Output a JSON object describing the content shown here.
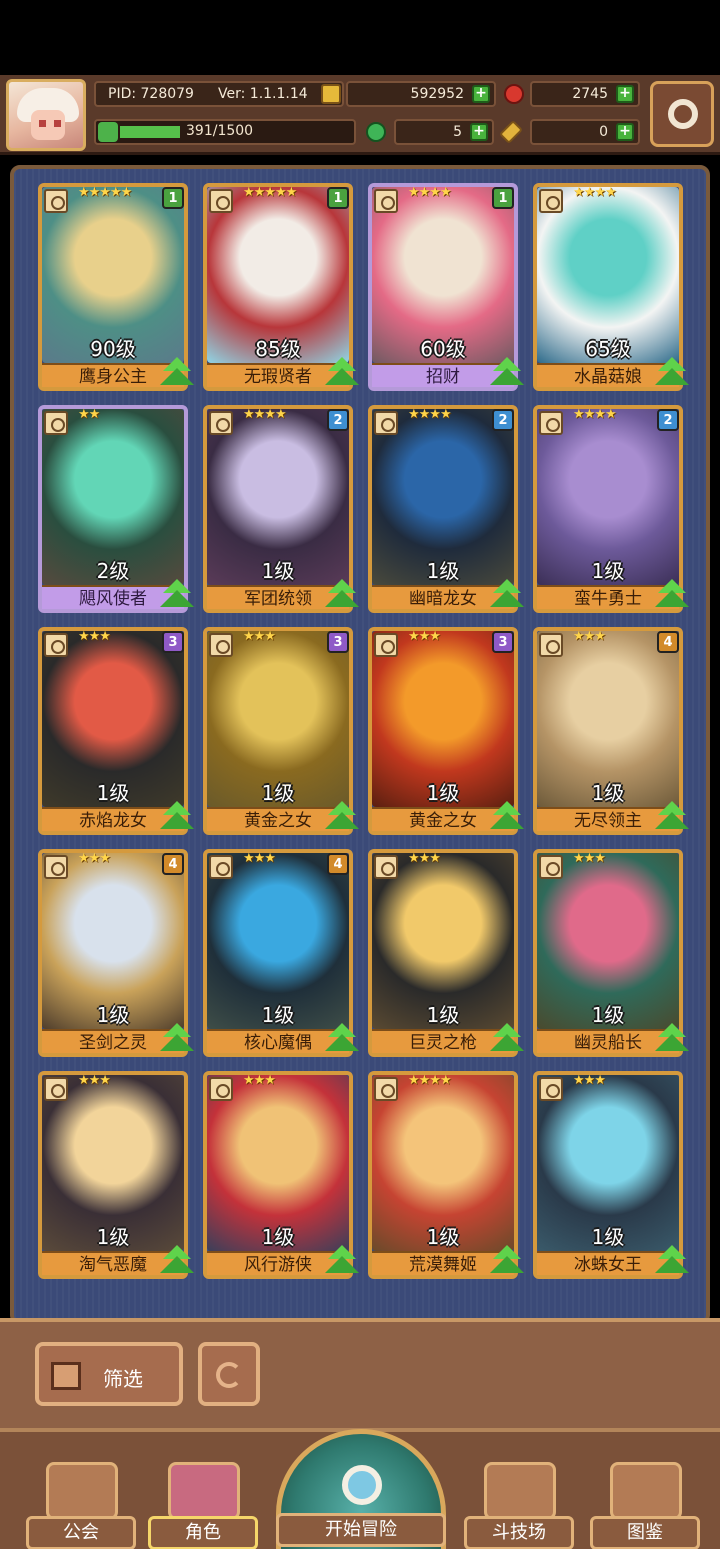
{
  "header": {
    "pid": "PID: 728079",
    "version": "Ver: 1.1.1.14",
    "gold": "592952",
    "gems": "2745",
    "energy": "391/1500",
    "energy_fraction": 0.26,
    "clover": "5",
    "keys": "0"
  },
  "cards": [
    {
      "name": "鹰身公主",
      "level": "90级",
      "stars": "★★★★★",
      "badge": "1",
      "badge_color": "#4aa23f",
      "frame": "gold",
      "art": [
        "#5b7a8a",
        "#e8d08b",
        "#4e8f86"
      ]
    },
    {
      "name": "无瑕贤者",
      "level": "85级",
      "stars": "★★★★★",
      "badge": "1",
      "badge_color": "#4aa23f",
      "frame": "gold",
      "art": [
        "#8fd6e6",
        "#f2ece6",
        "#b8363a"
      ]
    },
    {
      "name": "招财",
      "level": "60级",
      "stars": "★★★★",
      "badge": "1",
      "badge_color": "#4aa23f",
      "frame": "purple",
      "art": [
        "#6f5a62",
        "#f0e3d2",
        "#e46a86"
      ]
    },
    {
      "name": "水晶菇娘",
      "level": "65级",
      "stars": "★★★★",
      "badge": "",
      "badge_color": "",
      "frame": "gold",
      "art": [
        "#2d6a8a",
        "#5fd0c6",
        "#f3f4f3"
      ]
    },
    {
      "name": "飓风使者",
      "level": "2级",
      "stars": "★★",
      "badge": "",
      "badge_color": "",
      "frame": "purple",
      "art": [
        "#574a3e",
        "#62d6b6",
        "#2a4e3f"
      ]
    },
    {
      "name": "军团统领",
      "level": "1级",
      "stars": "★★★★",
      "badge": "2",
      "badge_color": "#3e8fd1",
      "frame": "gold",
      "art": [
        "#5a3b58",
        "#c9bde2",
        "#3a2c44"
      ]
    },
    {
      "name": "幽暗龙女",
      "level": "1级",
      "stars": "★★★★",
      "badge": "2",
      "badge_color": "#3e8fd1",
      "frame": "gold",
      "art": [
        "#4a4a3c",
        "#2b66a8",
        "#1f2b3c"
      ]
    },
    {
      "name": "蛮牛勇士",
      "level": "1级",
      "stars": "★★★★",
      "badge": "2",
      "badge_color": "#3e8fd1",
      "frame": "gold",
      "art": [
        "#3b2f56",
        "#a88dd0",
        "#6d5a9a"
      ]
    },
    {
      "name": "赤焰龙女",
      "level": "1级",
      "stars": "★★★",
      "badge": "3",
      "badge_color": "#8f5ac7",
      "frame": "gold",
      "art": [
        "#3f3a2a",
        "#e25a46",
        "#2a2a2a"
      ]
    },
    {
      "name": "黄金之女",
      "level": "1级",
      "stars": "★★★",
      "badge": "3",
      "badge_color": "#8f5ac7",
      "frame": "gold",
      "art": [
        "#6a5a2a",
        "#e3c25a",
        "#8a6a20"
      ]
    },
    {
      "name": "黄金之女",
      "level": "1级",
      "stars": "★★★",
      "badge": "3",
      "badge_color": "#8f5ac7",
      "frame": "gold",
      "art": [
        "#5a1f10",
        "#f39a2a",
        "#c1381e"
      ]
    },
    {
      "name": "无尽领主",
      "level": "1级",
      "stars": "★★★",
      "badge": "4",
      "badge_color": "#d28a2a",
      "frame": "gold",
      "art": [
        "#6d5a3a",
        "#e7cfa2",
        "#b59466"
      ]
    },
    {
      "name": "圣剑之灵",
      "level": "1级",
      "stars": "★★★",
      "badge": "4",
      "badge_color": "#d28a2a",
      "frame": "gold",
      "art": [
        "#4e3d2c",
        "#d8e1ec",
        "#c9a25a"
      ]
    },
    {
      "name": "核心魔偶",
      "level": "1级",
      "stars": "★★★",
      "badge": "4",
      "badge_color": "#d28a2a",
      "frame": "gold",
      "art": [
        "#3f4e48",
        "#3aa8e0",
        "#1f2f3a"
      ]
    },
    {
      "name": "巨灵之枪",
      "level": "1级",
      "stars": "★★★",
      "badge": "",
      "badge_color": "",
      "frame": "gold",
      "art": [
        "#5a4a32",
        "#f1c96a",
        "#2a2a2a"
      ]
    },
    {
      "name": "幽灵船长",
      "level": "1级",
      "stars": "★★★",
      "badge": "",
      "badge_color": "",
      "frame": "gold",
      "art": [
        "#4a4a2e",
        "#e06a8a",
        "#2f6a5a"
      ]
    },
    {
      "name": "淘气恶魔",
      "level": "1级",
      "stars": "★★★",
      "badge": "",
      "badge_color": "",
      "frame": "gold",
      "art": [
        "#5a4a3a",
        "#f2d49a",
        "#3a2f36"
      ]
    },
    {
      "name": "风行游侠",
      "level": "1级",
      "stars": "★★★",
      "badge": "",
      "badge_color": "",
      "frame": "gold",
      "art": [
        "#3a3f5a",
        "#f0c276",
        "#c4323a"
      ]
    },
    {
      "name": "荒漠舞姬",
      "level": "1级",
      "stars": "★★★★",
      "badge": "",
      "badge_color": "",
      "frame": "gold",
      "art": [
        "#6a4a2a",
        "#f4c47a",
        "#c64432"
      ]
    },
    {
      "name": "冰蛛女王",
      "level": "1级",
      "stars": "★★★",
      "badge": "",
      "badge_color": "",
      "frame": "gold",
      "art": [
        "#3a5a6a",
        "#7ed4e8",
        "#2a3a4a"
      ]
    }
  ],
  "actions": {
    "filter_label": "筛选"
  },
  "nav": {
    "guild": "公会",
    "characters": "角色",
    "adventure": "开始冒险",
    "arena": "斗技场",
    "codex": "图鉴"
  }
}
